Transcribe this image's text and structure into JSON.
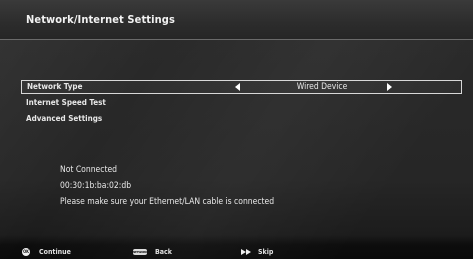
{
  "header": {
    "title": "Network/Internet Settings"
  },
  "menu": {
    "items": [
      {
        "label": "Network Type",
        "value": "Wired Device",
        "selected": true
      },
      {
        "label": "Internet Speed Test"
      },
      {
        "label": "Advanced Settings"
      }
    ]
  },
  "status": {
    "connection": "Not Connected",
    "mac_address": "00:30:1b:ba:02:db",
    "message": "Please make sure your Ethernet/LAN cable is connected"
  },
  "footer": {
    "continue_label": "Continue",
    "continue_icon_text": "OK",
    "back_label": "Back",
    "back_icon_text": "NETWORK",
    "skip_label": "Skip"
  },
  "icons": {
    "left": "arrow-left-icon",
    "right": "arrow-right-icon",
    "ok": "ok-button-icon",
    "back": "network-button-icon",
    "skip": "fast-forward-icon"
  }
}
